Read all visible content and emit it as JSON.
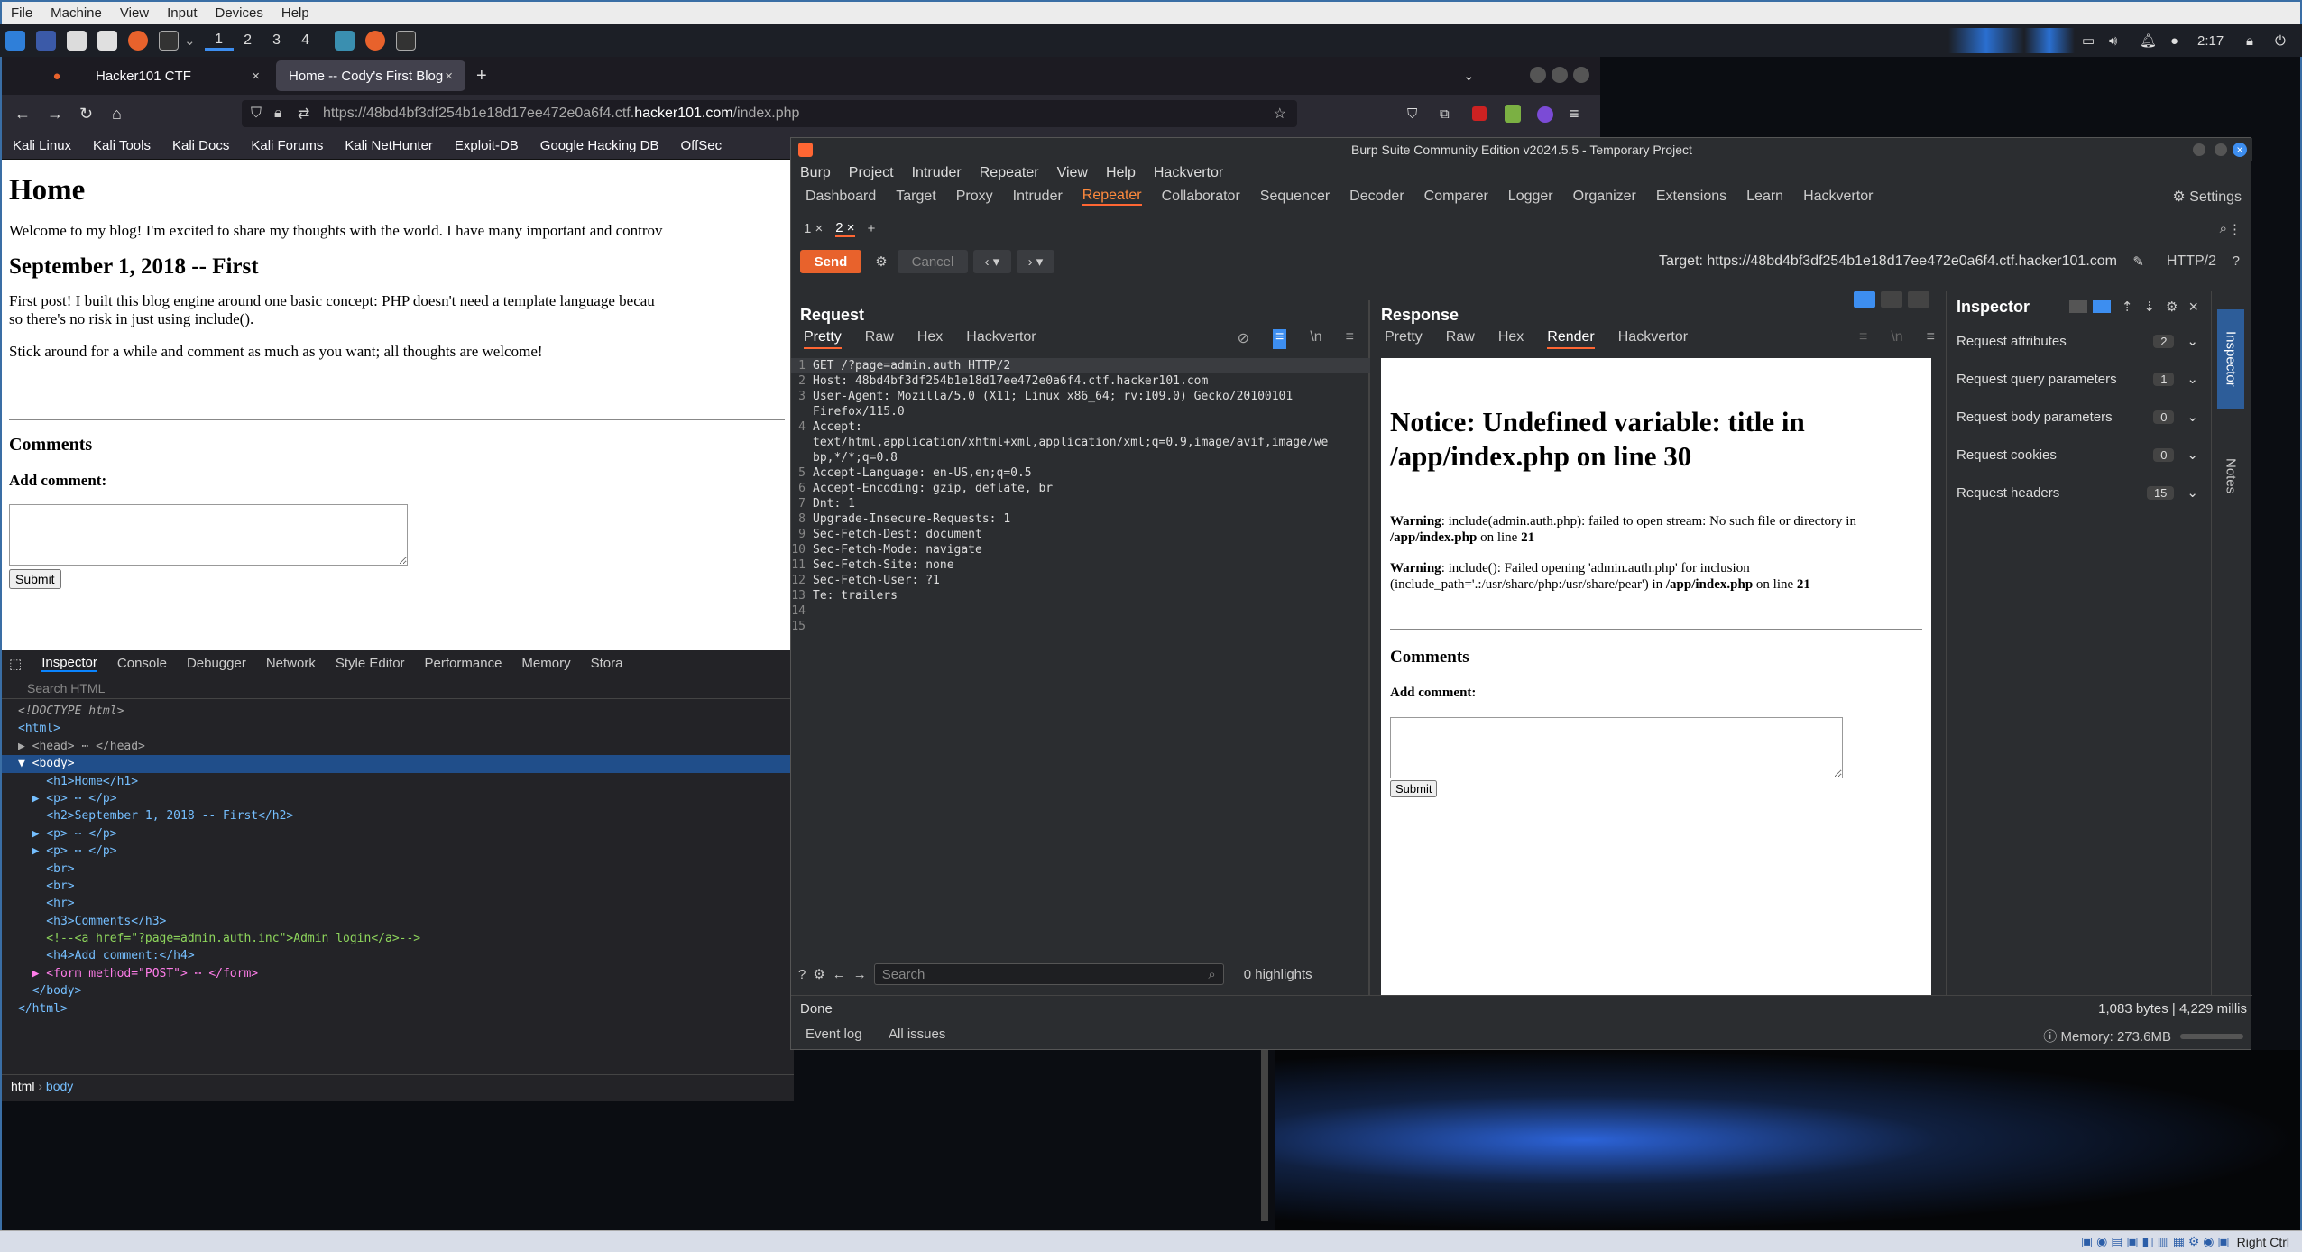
{
  "vm_menu": {
    "items": [
      "File",
      "Machine",
      "View",
      "Input",
      "Devices",
      "Help"
    ]
  },
  "panel": {
    "workspaces": [
      "1",
      "2",
      "3",
      "4"
    ],
    "clock": "2:17"
  },
  "firefox": {
    "tabs": [
      {
        "label": "Hacker101 CTF"
      },
      {
        "label": "Home -- Cody's First Blog"
      }
    ],
    "new_tab": "+",
    "url_prefix": "https://48bd4bf3df254b1e18d17ee472e0a6f4.ctf.",
    "url_domain": "hacker101.com",
    "url_suffix": "/index.php",
    "bookmarks": [
      "Kali Linux",
      "Kali Tools",
      "Kali Docs",
      "Kali Forums",
      "Kali NetHunter",
      "Exploit-DB",
      "Google Hacking DB",
      "OffSec"
    ]
  },
  "blog": {
    "h1": "Home",
    "p1": "Welcome to my blog! I'm excited to share my thoughts with the world. I have many important and controv",
    "h2": "September 1, 2018 -- First",
    "p2a": "First post! I built this blog engine around one basic concept: PHP doesn't need a template language becau",
    "p2b": "so there's no risk in just using include().",
    "p3": "Stick around for a while and comment as much as you want; all thoughts are welcome!",
    "comments": "Comments",
    "add_comment": "Add comment:",
    "submit": "Submit"
  },
  "devtools": {
    "tabs": [
      "Inspector",
      "Console",
      "Debugger",
      "Network",
      "Style Editor",
      "Performance",
      "Memory",
      "Stora"
    ],
    "search_placeholder": "Search HTML",
    "lines": [
      "<!DOCTYPE html>",
      "<html>",
      "▶ <head> ⋯ </head>",
      "▼ <body>",
      "    <h1>Home</h1>",
      "  ▶ <p> ⋯ </p>",
      "    <h2>September 1, 2018 -- First</h2>",
      "  ▶ <p> ⋯ </p>",
      "  ▶ <p> ⋯ </p>",
      "    <br>",
      "    <br>",
      "    <hr>",
      "    <h3>Comments</h3>",
      "    <!--<a href=\"?page=admin.auth.inc\">Admin login</a>-->",
      "    <h4>Add comment:</h4>",
      "  ▶ <form method=\"POST\"> ⋯ </form>",
      "  </body>",
      "</html>"
    ],
    "breadcrumb": [
      "html",
      "body"
    ]
  },
  "burp": {
    "title": "Burp Suite Community Edition v2024.5.5 - Temporary Project",
    "menu": [
      "Burp",
      "Project",
      "Intruder",
      "Repeater",
      "View",
      "Help",
      "Hackvertor"
    ],
    "tabs": [
      "Dashboard",
      "Target",
      "Proxy",
      "Intruder",
      "Repeater",
      "Collaborator",
      "Sequencer",
      "Decoder",
      "Comparer",
      "Logger",
      "Organizer",
      "Extensions",
      "Learn",
      "Hackvertor"
    ],
    "settings": "Settings",
    "subtabs": [
      "1 ×",
      "2 ×",
      "+"
    ],
    "send": "Send",
    "cancel": "Cancel",
    "target": "Target: https://48bd4bf3df254b1e18d17ee472e0a6f4.ctf.hacker101.com",
    "http": "HTTP/2",
    "request_title": "Request",
    "response_title": "Response",
    "req_tabs": [
      "Pretty",
      "Raw",
      "Hex",
      "Hackvertor"
    ],
    "resp_tabs": [
      "Pretty",
      "Raw",
      "Hex",
      "Render",
      "Hackvertor"
    ],
    "request_lines": [
      "GET /?page=admin.auth HTTP/2",
      "Host: 48bd4bf3df254b1e18d17ee472e0a6f4.ctf.hacker101.com",
      "User-Agent: Mozilla/5.0 (X11; Linux x86_64; rv:109.0) Gecko/20100101",
      "Firefox/115.0",
      "Accept:",
      "text/html,application/xhtml+xml,application/xml;q=0.9,image/avif,image/we",
      "bp,*/*;q=0.8",
      "Accept-Language: en-US,en;q=0.5",
      "Accept-Encoding: gzip, deflate, br",
      "Dnt: 1",
      "Upgrade-Insecure-Requests: 1",
      "Sec-Fetch-Dest: document",
      "Sec-Fetch-Mode: navigate",
      "Sec-Fetch-Site: none",
      "Sec-Fetch-User: ?1",
      "Te: trailers",
      "",
      ""
    ],
    "line_numbers": [
      "1",
      "2",
      "3",
      "",
      "4",
      "",
      "",
      "5",
      "6",
      "7",
      "8",
      "9",
      "10",
      "11",
      "12",
      "13",
      "14",
      "15"
    ],
    "search_placeholder": "Search",
    "highlights": "0 highlights",
    "render": {
      "notice": "Notice: Undefined variable: title in /app/index.php on line 30",
      "warn1_label": "Warning",
      "warn1": ": include(admin.auth.php): failed to open stream: No such file or directory in ",
      "warn1_file": "/app/index.php",
      "warn1_on": " on line ",
      "warn1_line": "21",
      "warn2_label": "Warning",
      "warn2": ": include(): Failed opening 'admin.auth.php' for inclusion (include_path='.:/usr/share/php:/usr/share/pear') in ",
      "warn2_file": "/app/index.php",
      "warn2_on": " on line ",
      "warn2_line": "21",
      "comments": "Comments",
      "add_comment": "Add comment:",
      "submit": "Submit"
    },
    "inspector": {
      "title": "Inspector",
      "rows": [
        {
          "label": "Request attributes",
          "count": "2"
        },
        {
          "label": "Request query parameters",
          "count": "1"
        },
        {
          "label": "Request body parameters",
          "count": "0"
        },
        {
          "label": "Request cookies",
          "count": "0"
        },
        {
          "label": "Request headers",
          "count": "15"
        }
      ],
      "side_inspector": "Inspector",
      "side_notes": "Notes"
    },
    "status_done": "Done",
    "status_bytes": "1,083 bytes | 4,229 millis",
    "event_log": "Event log",
    "all_issues": "All issues",
    "memory": "Memory: 273.6MB"
  },
  "taskbar": {
    "right_ctrl": "Right Ctrl"
  }
}
